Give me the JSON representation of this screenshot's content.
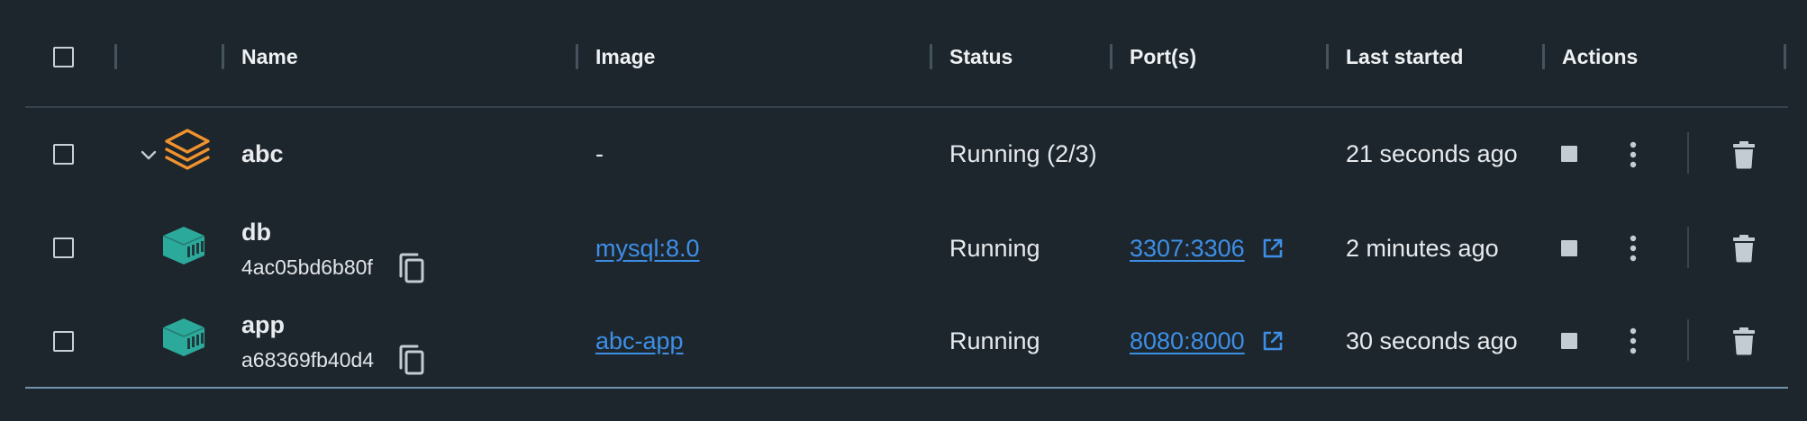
{
  "header": {
    "columns": [
      "Name",
      "Image",
      "Status",
      "Port(s)",
      "Last started",
      "Actions"
    ]
  },
  "rows": [
    {
      "type": "group",
      "name": "abc",
      "image": "-",
      "status": "Running (2/3)",
      "port": "",
      "last_started": "21 seconds ago"
    },
    {
      "type": "container",
      "name": "db",
      "id": "4ac05bd6b80f",
      "image": "mysql:8.0",
      "status": "Running",
      "port": "3307:3306",
      "last_started": "2 minutes ago"
    },
    {
      "type": "container",
      "name": "app",
      "id": "a68369fb40d4",
      "image": "abc-app",
      "status": "Running",
      "port": "8080:8000",
      "last_started": "30 seconds ago"
    }
  ],
  "icons": {
    "group": "stack-layers-icon",
    "container": "container-box-icon",
    "expand": "chevron-down-icon",
    "copy": "copy-icon",
    "external": "external-link-icon",
    "stop": "stop-icon",
    "more": "more-vertical-icon",
    "delete": "trash-icon"
  },
  "colors": {
    "background": "#1e262d",
    "link": "#3d8fe6",
    "group_icon": "#f0922e",
    "container_icon": "#2ba99a",
    "action_icon": "#c3ccd3"
  }
}
